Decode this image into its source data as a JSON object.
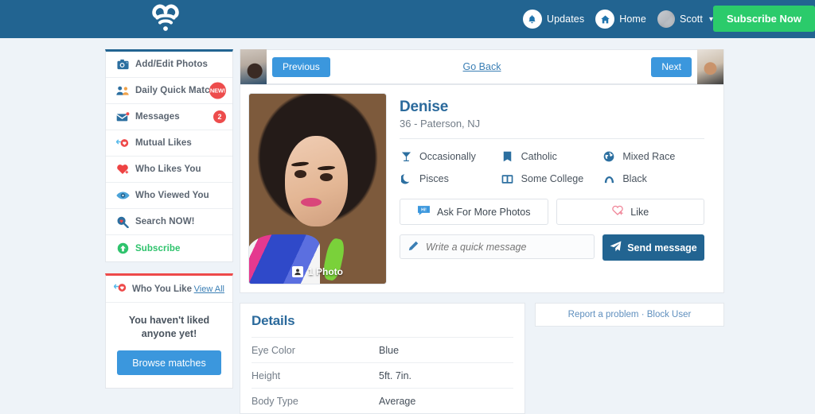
{
  "header": {
    "logo_icon": "heart-wifi-logo",
    "nav": [
      {
        "icon": "bell-icon",
        "label": "Updates"
      },
      {
        "icon": "home-icon",
        "label": "Home"
      }
    ],
    "user": {
      "name": "Scott",
      "caret": "▾",
      "avatar_icon": "user-avatar"
    },
    "subscribe_label": "Subscribe Now",
    "bar_color": "#226491",
    "subscribe_color": "#2bcb6b"
  },
  "sidebar": {
    "items": [
      {
        "icon": "camera-icon",
        "label": "Add/Edit Photos",
        "badge": null,
        "badge_type": null
      },
      {
        "icon": "people-icon",
        "label": "Daily Quick Match",
        "badge": "NEW!",
        "badge_type": "new"
      },
      {
        "icon": "envelope-icon",
        "label": "Messages",
        "badge": "2",
        "badge_type": "num"
      },
      {
        "icon": "mutual-likes-icon",
        "label": "Mutual Likes",
        "badge": null,
        "badge_type": null
      },
      {
        "icon": "heart-icon",
        "label": "Who Likes You",
        "badge": null,
        "badge_type": null
      },
      {
        "icon": "eye-icon",
        "label": "Who Viewed You",
        "badge": null,
        "badge_type": null
      },
      {
        "icon": "search-icon",
        "label": "Search NOW!",
        "badge": null,
        "badge_type": null
      },
      {
        "icon": "up-arrow-icon",
        "label": "Subscribe",
        "badge": null,
        "badge_type": null
      }
    ],
    "who_you_like": {
      "icon": "mutual-likes-icon",
      "title": "Who You Like",
      "view_all_label": "View All",
      "empty_message": "You haven't liked anyone yet!",
      "browse_label": "Browse matches",
      "accent_color": "#ee4a4a"
    }
  },
  "navstrip": {
    "previous_label": "Previous",
    "next_label": "Next",
    "go_back_label": "Go Back"
  },
  "profile": {
    "name": "Denise",
    "meta": "36 - Paterson, NJ",
    "photo_badge": "1 Photo",
    "photo_badge_icon": "portrait-icon",
    "attributes": [
      {
        "icon": "cocktail-icon",
        "label": "Occasionally"
      },
      {
        "icon": "book-closed-icon",
        "label": "Catholic"
      },
      {
        "icon": "globe-icon",
        "label": "Mixed Race"
      },
      {
        "icon": "moon-icon",
        "label": "Pisces"
      },
      {
        "icon": "book-open-icon",
        "label": "Some College"
      },
      {
        "icon": "hair-icon",
        "label": "Black"
      }
    ],
    "ask_photos_label": "Ask For More Photos",
    "ask_photos_icon": "chat-bubble-hi-icon",
    "like_label": "Like",
    "like_icon": "heart-outline-icon",
    "message_placeholder": "Write a quick message",
    "message_value": "",
    "message_icon": "pencil-icon",
    "send_label": "Send message",
    "send_icon": "paper-plane-icon"
  },
  "details": {
    "title": "Details",
    "rows": [
      {
        "key": "Eye Color",
        "value": "Blue"
      },
      {
        "key": "Height",
        "value": "5ft. 7in."
      },
      {
        "key": "Body Type",
        "value": "Average"
      }
    ]
  },
  "report": {
    "report_label": "Report a problem",
    "separator": " · ",
    "block_label": "Block User"
  }
}
